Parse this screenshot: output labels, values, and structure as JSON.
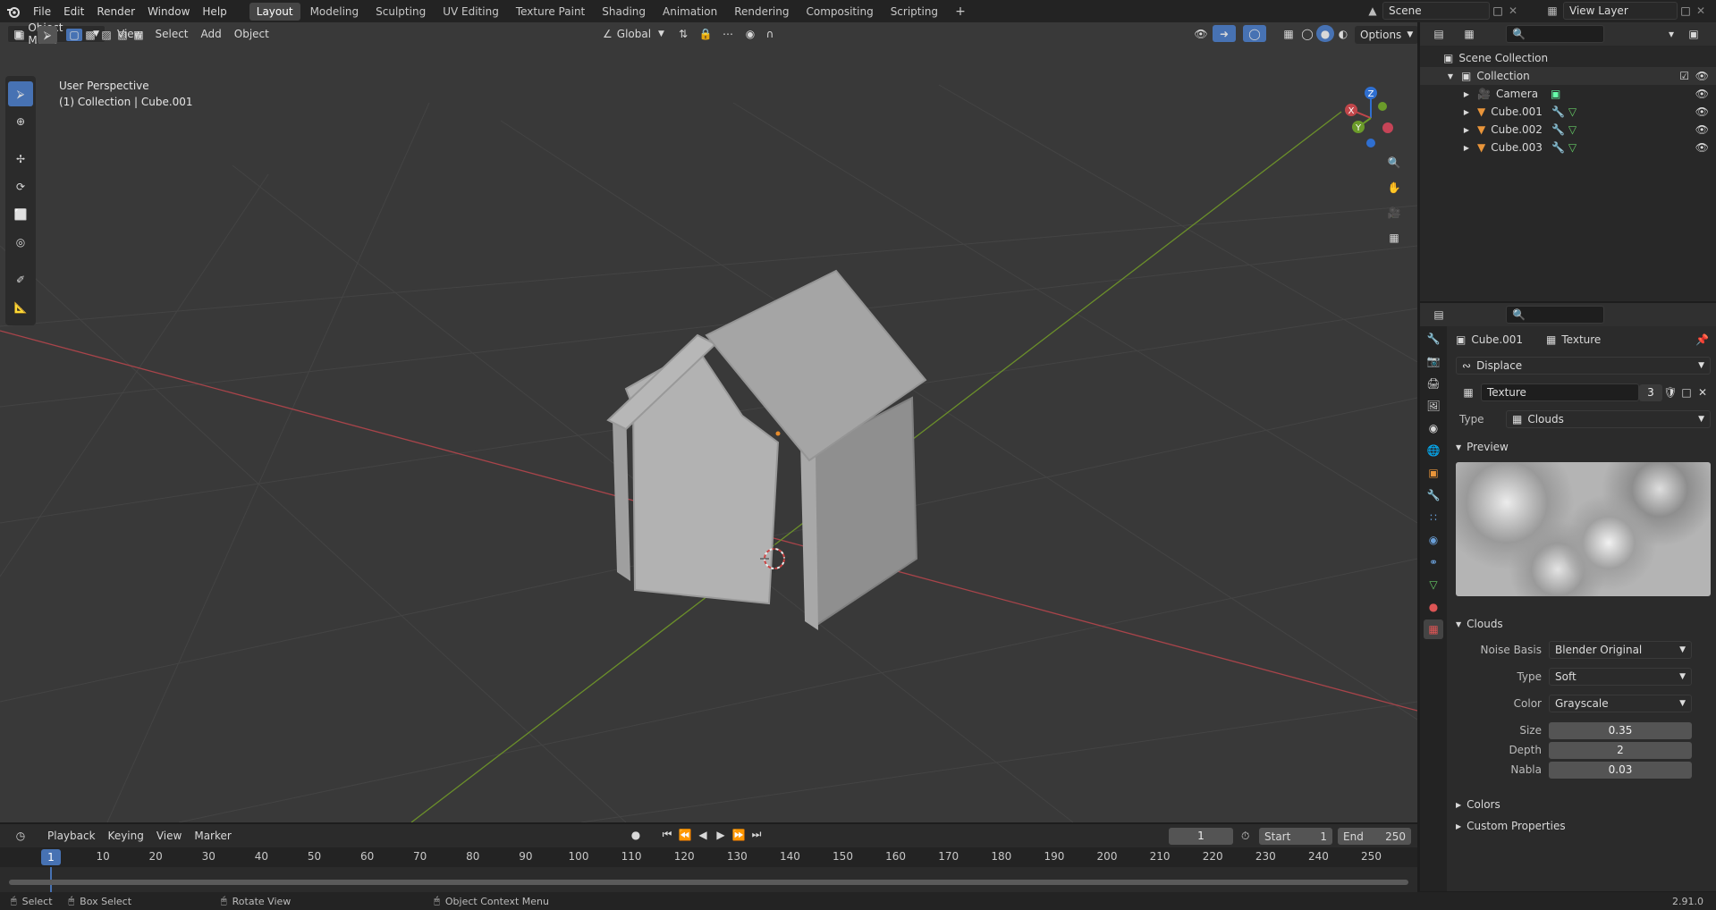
{
  "topbar": {
    "menus": [
      "File",
      "Edit",
      "Render",
      "Window",
      "Help"
    ],
    "workspaces": [
      "Layout",
      "Modeling",
      "Sculpting",
      "UV Editing",
      "Texture Paint",
      "Shading",
      "Animation",
      "Rendering",
      "Compositing",
      "Scripting"
    ],
    "add_tab": "+",
    "scene": "Scene",
    "view_layer": "View Layer"
  },
  "viewport": {
    "mode": "Object Mode",
    "menus": [
      "View",
      "Select",
      "Add",
      "Object"
    ],
    "transform": "Global",
    "options": "Options",
    "perspective": "User Perspective",
    "collection_info": "(1) Collection | Cube.001",
    "gizmo": {
      "z": "Z",
      "x": "X",
      "y": "Y"
    }
  },
  "outliner": {
    "root": "Scene Collection",
    "collection": "Collection",
    "items": [
      {
        "name": "Camera",
        "type": "camera"
      },
      {
        "name": "Cube.001",
        "type": "mesh"
      },
      {
        "name": "Cube.002",
        "type": "mesh"
      },
      {
        "name": "Cube.003",
        "type": "mesh"
      }
    ]
  },
  "properties": {
    "object": "Cube.001",
    "tab": "Texture",
    "modifier": "Displace",
    "texture_name": "Texture",
    "users": "3",
    "type_label": "Type",
    "type_value": "Clouds",
    "preview_header": "Preview",
    "clouds_header": "Clouds",
    "noise_basis_label": "Noise Basis",
    "noise_basis_value": "Blender Original",
    "cloud_type_label": "Type",
    "cloud_type_value": "Soft",
    "color_label": "Color",
    "color_value": "Grayscale",
    "size_label": "Size",
    "size_value": "0.35",
    "depth_label": "Depth",
    "depth_value": "2",
    "nabla_label": "Nabla",
    "nabla_value": "0.03",
    "colors_header": "Colors",
    "custom_header": "Custom Properties"
  },
  "timeline": {
    "menus": [
      "Playback",
      "Keying",
      "View",
      "Marker"
    ],
    "current_frame": "1",
    "start_label": "Start",
    "start": "1",
    "end_label": "End",
    "end": "250",
    "ticks": [
      "10",
      "20",
      "30",
      "40",
      "50",
      "60",
      "70",
      "80",
      "90",
      "100",
      "110",
      "120",
      "130",
      "140",
      "150",
      "160",
      "170",
      "180",
      "190",
      "200",
      "210",
      "220",
      "230",
      "240",
      "250"
    ]
  },
  "statusbar": {
    "select": "Select",
    "box_select": "Box Select",
    "rotate": "Rotate View",
    "context": "Object Context Menu",
    "version": "2.91.0"
  },
  "colors": {
    "accent": "#4772b3",
    "x_axis": "#c0464a",
    "y_axis": "#6b9b2a",
    "z_axis": "#2f6fd0"
  }
}
